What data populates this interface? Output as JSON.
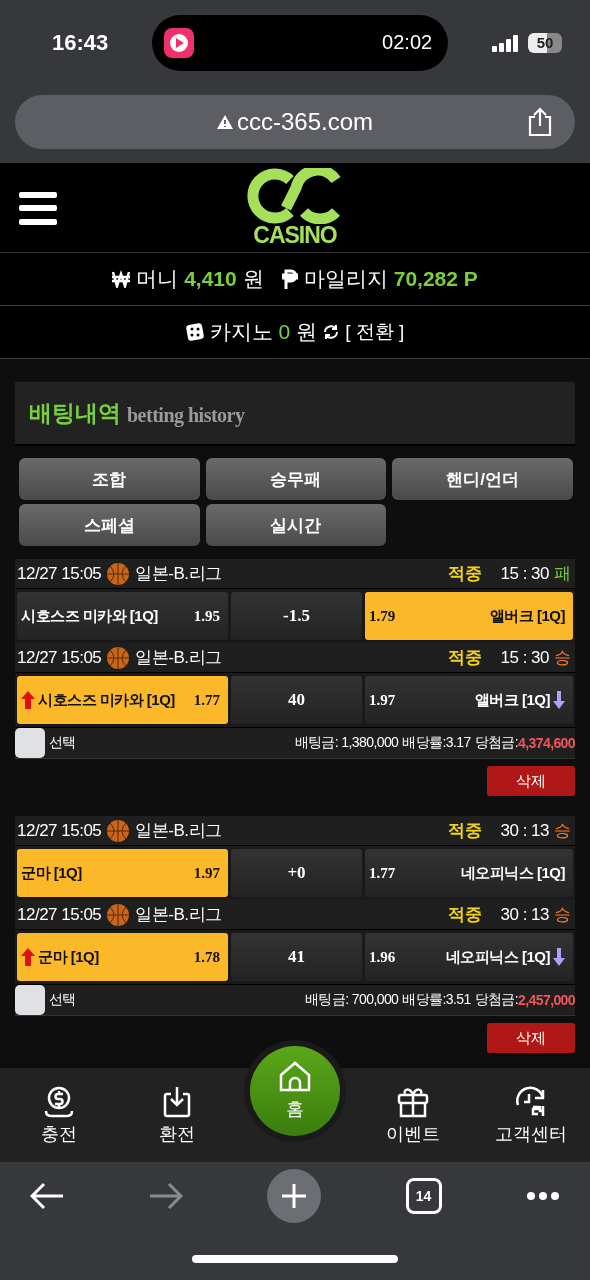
{
  "status_bar": {
    "time": "16:43",
    "timer": "02:02",
    "battery": "50"
  },
  "browser": {
    "url": "ccc-365.com",
    "tab_count": "14"
  },
  "header": {
    "logo_text": "CASINO"
  },
  "wallet": {
    "money_label": "머니",
    "money_value": "4,410",
    "money_unit": "원",
    "mileage_label": "마일리지",
    "mileage_value": "70,282 P",
    "casino_label": "카지노",
    "casino_value": "0",
    "casino_unit": "원",
    "switch_label": "[ 전환 ]"
  },
  "section": {
    "title": "배팅내역",
    "subtitle": "betting history"
  },
  "filters": [
    "조합",
    "승무패",
    "핸디/언더",
    "스페셜",
    "실시간"
  ],
  "bets": [
    {
      "games": [
        {
          "date": "12/27 15:05",
          "league": "일본-B.리그",
          "status": "적중",
          "score": "15 : 30",
          "outcome": "패",
          "color": "#7ac943",
          "home": {
            "name": "시호스즈 미카와 [1Q]",
            "odds": "1.95",
            "picked": false
          },
          "line": "-1.5",
          "away": {
            "name": "앨버크 [1Q]",
            "odds": "1.79",
            "picked": true
          }
        },
        {
          "date": "12/27 15:05",
          "league": "일본-B.리그",
          "status": "적중",
          "score": "15 : 30",
          "outcome": "승",
          "color": "#f07a2a",
          "home": {
            "name": "시호스즈 미카와 [1Q]",
            "odds": "1.77",
            "picked": true,
            "odds_up": true
          },
          "line": "40",
          "away": {
            "name": "앨버크 [1Q]",
            "odds": "1.97",
            "picked": false,
            "odds_down": true
          }
        }
      ],
      "select_label": "선택",
      "checked": false,
      "stake": "배팅금: 1,380,000",
      "rate": "배당률:3.17",
      "win_label": "당첨금:",
      "win": "4,374,600",
      "delete_label": "삭제"
    },
    {
      "games": [
        {
          "date": "12/27 15:05",
          "league": "일본-B.리그",
          "status": "적중",
          "score": "30 : 13",
          "outcome": "승",
          "color": "#f07a2a",
          "home": {
            "name": "군마 [1Q]",
            "odds": "1.97",
            "picked": true
          },
          "line": "+0",
          "away": {
            "name": "네오피닉스 [1Q]",
            "odds": "1.77",
            "picked": false
          }
        },
        {
          "date": "12/27 15:05",
          "league": "일본-B.리그",
          "status": "적중",
          "score": "30 : 13",
          "outcome": "승",
          "color": "#f07a2a",
          "home": {
            "name": "군마 [1Q]",
            "odds": "1.78",
            "picked": true,
            "odds_up": true
          },
          "line": "41",
          "away": {
            "name": "네오피닉스 [1Q]",
            "odds": "1.96",
            "picked": false,
            "odds_down": true
          }
        }
      ],
      "select_label": "선택",
      "checked": false,
      "stake": "배팅금: 700,000",
      "rate": "배당률:3.51",
      "win_label": "당첨금:",
      "win": "2,457,000",
      "delete_label": "삭제"
    }
  ],
  "bottom_nav": [
    {
      "label": "충전",
      "kind": "tab"
    },
    {
      "label": "환전",
      "kind": "tab"
    },
    {
      "label": "홈",
      "kind": "center"
    },
    {
      "label": "이벤트",
      "kind": "tab"
    },
    {
      "label": "고객센터",
      "kind": "tab"
    }
  ]
}
